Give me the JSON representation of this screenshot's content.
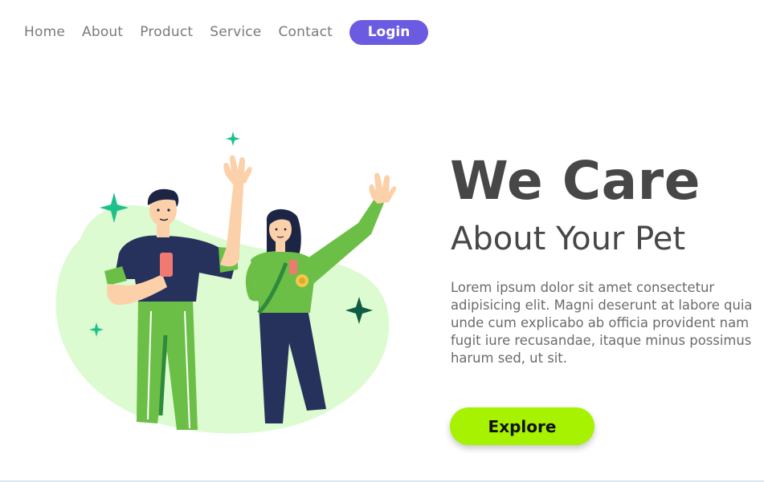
{
  "nav": {
    "items": [
      {
        "label": "Home"
      },
      {
        "label": "About"
      },
      {
        "label": "Product"
      },
      {
        "label": "Service"
      },
      {
        "label": "Contact"
      }
    ],
    "login_label": "Login"
  },
  "hero": {
    "title": "We Care",
    "subtitle": "About Your Pet",
    "body": "Lorem ipsum dolor sit amet consectetur adipisicing elit. Magni deserunt at labore quia unde cum explicabo ab officia provident nam fugit iure recusandae, itaque minus possimus harum sed, ut sit.",
    "cta_label": "Explore"
  },
  "colors": {
    "accent": "#6a5be0",
    "cta": "#a6f200",
    "heading": "#474747",
    "blob": "#dcfbd0",
    "shirt_green": "#6cbf46",
    "navy": "#26325c",
    "sparkle_teal": "#1cc28a",
    "sparkle_dark": "#0f5b45"
  },
  "icons": {
    "sparkles": [
      "sparkle-icon"
    ]
  }
}
